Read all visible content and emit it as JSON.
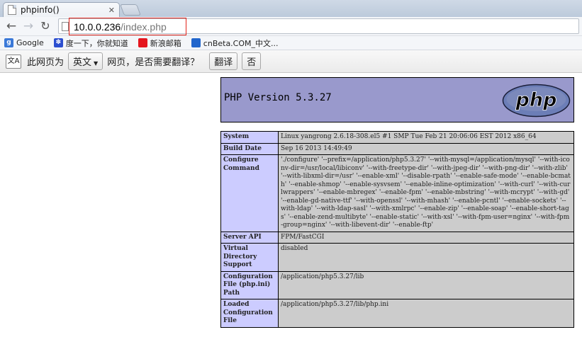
{
  "browser": {
    "tab": {
      "title": "phpinfo()",
      "close": "✕"
    },
    "address": {
      "host": "10.0.0.236",
      "path": "/index.php"
    },
    "bookmarks": [
      {
        "label": "Google",
        "icon": "google-icon"
      },
      {
        "label": "度一下，你就知道",
        "icon": "baidu-icon"
      },
      {
        "label": "新浪邮箱",
        "icon": "sina-icon"
      },
      {
        "label": "cnBeta.COM_中文...",
        "icon": "cnbeta-icon"
      }
    ],
    "translate": {
      "prefix": "此网页为",
      "language": "英文",
      "suffix": "网页，是否需要翻译？",
      "translate_button": "翻译",
      "no_button": "否"
    }
  },
  "page": {
    "version_title": "PHP Version 5.3.27",
    "logo_text": "php",
    "rows": [
      {
        "key": "System",
        "value": "Linux yangrong 2.6.18-308.el5 #1 SMP Tue Feb 21 20:06:06 EST 2012 x86_64"
      },
      {
        "key": "Build Date",
        "value": "Sep 16 2013 14:49:49"
      },
      {
        "key": "Configure Command",
        "value": "'./configure' '--prefix=/application/php5.3.27' '--with-mysql=/application/mysql' '--with-iconv-dir=/usr/local/libiconv' '--with-freetype-dir' '--with-jpeg-dir' '--with-png-dir' '--with-zlib' '--with-libxml-dir=/usr' '--enable-xml' '--disable-rpath' '--enable-safe-mode' '--enable-bcmath' '--enable-shmop' '--enable-sysvsem' '--enable-inline-optimization' '--with-curl' '--with-curlwrappers' '--enable-mbregex' '--enable-fpm' '--enable-mbstring' '--with-mcrypt' '--with-gd' '--enable-gd-native-ttf' '--with-openssl' '--with-mhash' '--enable-pcntl' '--enable-sockets' '--with-ldap' '--with-ldap-sasl' '--with-xmlrpc' '--enable-zip' '--enable-soap' '--enable-short-tags' '--enable-zend-multibyte' '--enable-static' '--with-xsl' '--with-fpm-user=nginx' '--with-fpm-group=nginx' '--with-libevent-dir' '--enable-ftp'"
      },
      {
        "key": "Server API",
        "value": "FPM/FastCGI"
      },
      {
        "key": "Virtual Directory Support",
        "value": "disabled"
      },
      {
        "key": "Configuration File (php.ini) Path",
        "value": "/application/php5.3.27/lib"
      },
      {
        "key": "Loaded Configuration File",
        "value": "/application/php5.3.27/lib/php.ini"
      }
    ]
  }
}
